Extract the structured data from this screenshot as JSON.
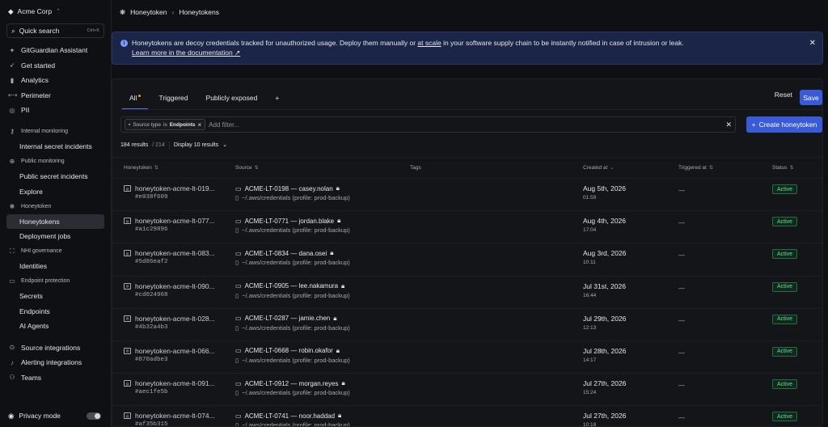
{
  "sidebar": {
    "org": "Acme Corp",
    "search_label": "Quick search",
    "search_shortcut": "Ctrl+K",
    "top_items": [
      {
        "label": "GitGuardian Assistant",
        "icon": "sparkle-icon"
      },
      {
        "label": "Get started",
        "icon": "rocket-icon"
      },
      {
        "label": "Analytics",
        "icon": "chart-icon"
      },
      {
        "label": "Perimeter",
        "icon": "perimeter-icon"
      },
      {
        "label": "PII",
        "icon": "fingerprint-icon"
      }
    ],
    "sections": {
      "internal": "Internal monitoring",
      "internal_items": [
        "Internal secret incidents"
      ],
      "public": "Public monitoring",
      "public_items": [
        "Public secret incidents",
        "Explore"
      ],
      "honeytoken": "Honeytoken",
      "honeytoken_items": [
        "Honeytokens",
        "Deployment jobs"
      ],
      "nhi": "NHI governance",
      "nhi_items": [
        "Identities"
      ],
      "endpoint": "Endpoint protection",
      "endpoint_items": [
        "Secrets",
        "Endpoints",
        "AI Agents"
      ]
    },
    "bottom_items": [
      "Source integrations",
      "Alerting integrations",
      "Teams"
    ],
    "privacy_label": "Privacy mode"
  },
  "breadcrumb": {
    "parent": "Honeytoken",
    "current": "Honeytokens"
  },
  "banner": {
    "text_before": "Honeytokens are decoy credentials tracked for unauthorized usage. Deploy them manually or ",
    "link_scale": "at scale",
    "text_after": " in your software supply chain to be instantly notified in case of intrusion or leak.",
    "learn_more": "Learn more in the documentation ↗"
  },
  "tabs": [
    "All",
    "Triggered",
    "Publicly exposed",
    "+"
  ],
  "actions": {
    "reset": "Reset",
    "save": "Save",
    "create": "Create honeytoken"
  },
  "filter": {
    "chip_label": "Source type",
    "chip_op": "is",
    "chip_value": "Endpoints",
    "placeholder": "Add filter..."
  },
  "results": {
    "count": "184 results",
    "total": "/ 214",
    "display": "Display 10 results"
  },
  "columns": {
    "honeytoken": "Honeytoken",
    "source": "Source",
    "tags": "Tags",
    "created": "Created at",
    "triggered": "Triggered at",
    "status": "Status"
  },
  "rows": [
    {
      "name": "honeytoken-acme-lt-019...",
      "hash": "#e038f609",
      "device": "ACME-LT-0198 — casey.nolan",
      "path": "~/.aws/credentials (profile: prod-backup)",
      "date": "Aug 5th, 2026",
      "time": "01:59",
      "triggered": "—",
      "status": "Active"
    },
    {
      "name": "honeytoken-acme-lt-077...",
      "hash": "#a1c29896",
      "device": "ACME-LT-0771 — jordan.blake",
      "path": "~/.aws/credentials (profile: prod-backup)",
      "date": "Aug 4th, 2026",
      "time": "17:04",
      "triggered": "—",
      "status": "Active"
    },
    {
      "name": "honeytoken-acme-lt-083...",
      "hash": "#5d86eaf2",
      "device": "ACME-LT-0834 — dana.osei",
      "path": "~/.aws/credentials (profile: prod-backup)",
      "date": "Aug 3rd, 2026",
      "time": "10:11",
      "triggered": "—",
      "status": "Active"
    },
    {
      "name": "honeytoken-acme-lt-090...",
      "hash": "#cd024968",
      "device": "ACME-LT-0905 — lee.nakamura",
      "path": "~/.aws/credentials (profile: prod-backup)",
      "date": "Jul 31st, 2026",
      "time": "16:44",
      "triggered": "—",
      "status": "Active"
    },
    {
      "name": "honeytoken-acme-lt-028...",
      "hash": "#4b32a4b3",
      "device": "ACME-LT-0287 — jamie.chen",
      "path": "~/.aws/credentials (profile: prod-backup)",
      "date": "Jul 29th, 2026",
      "time": "12:13",
      "triggered": "—",
      "status": "Active"
    },
    {
      "name": "honeytoken-acme-lt-066...",
      "hash": "#870adbe3",
      "device": "ACME-LT-0668 — robin.okafor",
      "path": "~/.aws/credentials (profile: prod-backup)",
      "date": "Jul 28th, 2026",
      "time": "14:17",
      "triggered": "—",
      "status": "Active"
    },
    {
      "name": "honeytoken-acme-lt-091...",
      "hash": "#aec1fe5b",
      "device": "ACME-LT-0912 — morgan.reyes",
      "path": "~/.aws/credentials (profile: prod-backup)",
      "date": "Jul 27th, 2026",
      "time": "15:24",
      "triggered": "—",
      "status": "Active"
    },
    {
      "name": "honeytoken-acme-lt-074...",
      "hash": "#af35b315",
      "device": "ACME-LT-0741 — noor.haddad",
      "path": "~/.aws/credentials (profile: prod-backup)",
      "date": "Jul 27th, 2026",
      "time": "10:18",
      "triggered": "—",
      "status": "Active"
    }
  ]
}
